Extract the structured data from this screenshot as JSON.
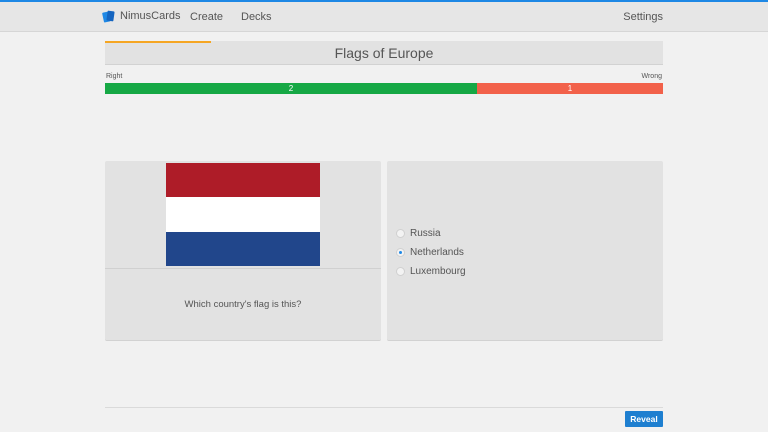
{
  "navbar": {
    "brand": "NimusCards",
    "links": {
      "create": "Create",
      "decks": "Decks",
      "settings": "Settings"
    }
  },
  "deck": {
    "title": "Flags of Europe",
    "progress_fraction": 0.19
  },
  "score": {
    "right_label": "Right",
    "wrong_label": "Wrong",
    "right_count": "2",
    "wrong_count": "1"
  },
  "card": {
    "flag_colors": [
      "#ae1c28",
      "#ffffff",
      "#21468b"
    ],
    "question": "Which country's flag is this?",
    "options": [
      {
        "label": "Russia",
        "selected": false
      },
      {
        "label": "Netherlands",
        "selected": true
      },
      {
        "label": "Luxembourg",
        "selected": false
      }
    ]
  },
  "actions": {
    "reveal": "Reveal"
  },
  "colors": {
    "accent": "#1e88e5",
    "right": "#16a845",
    "wrong": "#f2614a",
    "progress": "#f5a623"
  }
}
